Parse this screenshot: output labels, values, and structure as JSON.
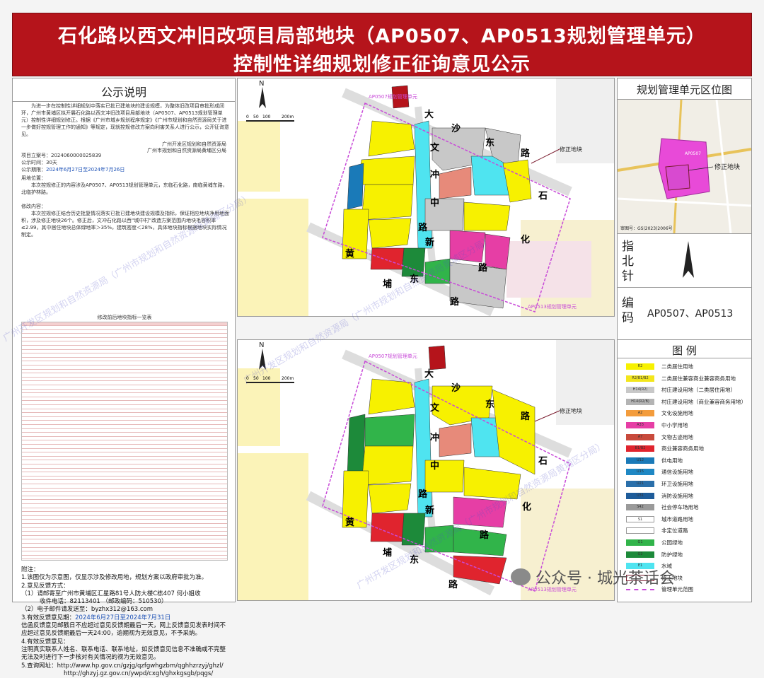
{
  "header": {
    "title_line1": "石化路以西文冲旧改项目局部地块（AP0507、AP0513规划管理单元）",
    "title_line2": "控制性详细规划修正征询意见公示"
  },
  "notice": {
    "title": "公示说明",
    "intro": "为进一步在控制性详细规划中落实已批已建地块的建设规模，为整体旧改项目审批形成闭环，广州市黄埔区拟开展石化路以西文冲旧改项目局部地块（AP0507、AP0513规划管理单元）控制性详细规划修正。根据《广州市城乡规划程序规定》《广州市规划和自然资源局关于进一步做好控规管理工作的通知》等规定，现就控规修改方案向利害关系人进行公示，公开征询意见。",
    "org1": "广州开发区规划和自然资源局",
    "org2": "广州市规划和自然资源局黄埔区分局",
    "project_no": "项目立案号：2024060000025839",
    "period_days": "公示时间：30天",
    "period_label": "公示期限：",
    "period_value": "2024年6月27日至2024年7月26日",
    "scope_label": "用地位置：",
    "scope_text": "本次控规修正的内容涉及AP0507、AP0513规划管理单元，东临石化路，南临黄埔东路，北临护林路。",
    "content_label": "修改内容：",
    "content_text": "本次控规修正结合历史批复情况落实已批已建地块建设规模及指标，保证相应地块净用地面积，涉及修正地块26个。修正后，文冲石化路以西“城中村”改造方案范围内地块毛容积率≤2.99，其中居住地块总体绿地率＞35%，建筑密度＜28%，具体地块指标根据地块实际情况制定。",
    "table_caption": "修改前后地块指标一览表",
    "attach_title": "附注：",
    "note1": "1.该图仅为示意图，仅显示涉及修改用地，规划方案以政府审批为准。",
    "note2": "2.意见反馈方式：",
    "note2a": "（1）请邮寄至广州市黄埔区汇星路81号人防大楼C栋407 何小姐收",
    "note2b": "收件电话：82113401 （邮政编码：510530）",
    "note2c_label": "（2）电子邮件请发送至：",
    "note2c_value": "byzhx312@163.com",
    "note3_label": "3.有效反馈意见期：",
    "note3_value": "2024年6月27日至2024年7月31日",
    "note3_text": "信函反馈意见邮戳日不应超过意见反馈期最后一天，网上反馈意见发表时间不应超过意见反馈期最后一天24:00，逾期视为无效意见，不予采纳。",
    "note4": "4.有效反馈意见：",
    "note4_text": "注明真实联系人姓名、联系电话、联系地址，如反馈意见信息不准确或不完整无法及时进行下一步核对有关情况的视为无效意见。",
    "note5": "5.查询网址：http://www.hp.gov.cn/gzjg/qzfgwhgzbm/qghhzrzyj/ghzl/",
    "note5b": "http://ghzyj.gz.gov.cn/ywpd/cxgh/ghxkgsgb/pqgs/"
  },
  "map": {
    "top_unit_label": "AP0507规划管理单元",
    "bottom_unit_label": "AP0513规划管理单元",
    "modify_label": "修正地块",
    "scale_labels": [
      "0",
      "50",
      "100",
      "200m"
    ],
    "north": "N",
    "roads": [
      "大",
      "沙",
      "东",
      "路",
      "文",
      "冲",
      "中",
      "路",
      "石",
      "化",
      "路",
      "黄",
      "埔",
      "东",
      "路",
      "新"
    ]
  },
  "right": {
    "location_title": "规划管理单元区位图",
    "loc_modify": "修正地块",
    "loc_unit": "AP0507",
    "review_no": "审图号：GS(2023)2006号",
    "compass_label": "指北针",
    "code_label": "编码",
    "code_value": "AP0507、AP0513",
    "legend_title": "图 例",
    "legend": [
      {
        "code": "R2",
        "label": "二类居住用地",
        "color": "#f7f100"
      },
      {
        "code": "R2/B1/B2",
        "label": "二类居住兼容商业兼容商务用地",
        "color": "#f3e61c"
      },
      {
        "code": "H14(R2)",
        "label": "村庄建设用地（二类居住用地）",
        "color": "#c8c8c8"
      },
      {
        "code": "H14(R2/B)",
        "label": "村庄建设用地（商业兼容商务用地）",
        "color": "#b4b4b4"
      },
      {
        "code": "A2",
        "label": "文化设施用地",
        "color": "#f39c3c"
      },
      {
        "code": "A33",
        "label": "中小学用地",
        "color": "#e63ea5"
      },
      {
        "code": "A7",
        "label": "文物古迹用地",
        "color": "#c84a3c"
      },
      {
        "code": "B1/B2",
        "label": "商业兼容商务用地",
        "color": "#e0242e"
      },
      {
        "code": "U12",
        "label": "供电用地",
        "color": "#1a7ab8"
      },
      {
        "code": "U15",
        "label": "通信设施用地",
        "color": "#1f88c4"
      },
      {
        "code": "U21",
        "label": "环卫设施用地",
        "color": "#2a6faa"
      },
      {
        "code": "U31",
        "label": "消防设施用地",
        "color": "#1e5c9a"
      },
      {
        "code": "S42",
        "label": "社会停车场用地",
        "color": "#9a9a9a"
      },
      {
        "code": "S1",
        "label": "城市道路用地",
        "color": "#ffffff"
      },
      {
        "code": "",
        "label": "非定位道路",
        "color": "#ffffff"
      },
      {
        "code": "G1",
        "label": "公园绿地",
        "color": "#31b44a"
      },
      {
        "code": "G2",
        "label": "防护绿地",
        "color": "#1d8a3a"
      },
      {
        "code": "E1",
        "label": "水域",
        "color": "#4fe4f0"
      },
      {
        "code": "",
        "label": "修正地块",
        "color": "#7a1b2e"
      },
      {
        "code": "",
        "label": "管理单元范围",
        "color": "#c84ad8"
      }
    ]
  },
  "watermark": "广州开发区规划和自然资源局（广州市规划和自然资源局黄埔区分局）",
  "footer": {
    "wechat": "公众号 · 城光茶话会"
  }
}
